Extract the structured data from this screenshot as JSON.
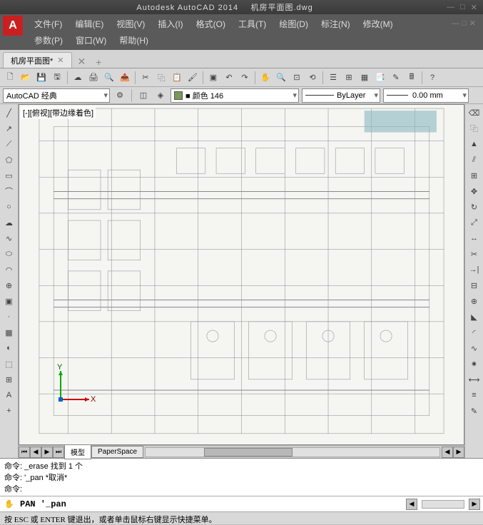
{
  "app": {
    "title": "Autodesk AutoCAD 2014",
    "document": "机房平面图.dwg"
  },
  "menu": {
    "row1": [
      {
        "label": "文件(F)"
      },
      {
        "label": "编辑(E)"
      },
      {
        "label": "视图(V)"
      },
      {
        "label": "插入(I)"
      },
      {
        "label": "格式(O)"
      },
      {
        "label": "工具(T)"
      },
      {
        "label": "绘图(D)"
      },
      {
        "label": "标注(N)"
      },
      {
        "label": "修改(M)"
      }
    ],
    "row2": [
      {
        "label": "参数(P)"
      },
      {
        "label": "窗口(W)"
      },
      {
        "label": "帮助(H)"
      }
    ]
  },
  "tabs": [
    {
      "label": "机房平面图*"
    }
  ],
  "props": {
    "workspace": "AutoCAD 经典",
    "colorLabel": "■ 颜色 146",
    "linetype": "ByLayer",
    "lineweight": "0.00 mm"
  },
  "view": {
    "label": "[-][俯视][带边缘着色]"
  },
  "sheets": {
    "model": "模型",
    "paper": "PaperSpace"
  },
  "commandHistory": [
    "命令: _erase 找到 1 个",
    "命令: '_pan *取消*",
    "命令:"
  ],
  "commandInput": "PAN '_pan",
  "statusText": "按 ESC 或 ENTER 键退出，或者单击鼠标右键显示快捷菜单。",
  "icons": {
    "newdoc": "🗋",
    "open": "📂",
    "save": "💾",
    "print": "🖨",
    "preview": "🔍",
    "cut": "✂",
    "copy": "⿻",
    "paste": "📋",
    "match": "🖌",
    "undo": "↶",
    "redo": "↷",
    "pan": "✋",
    "zoom": "🔍",
    "help": "?"
  }
}
